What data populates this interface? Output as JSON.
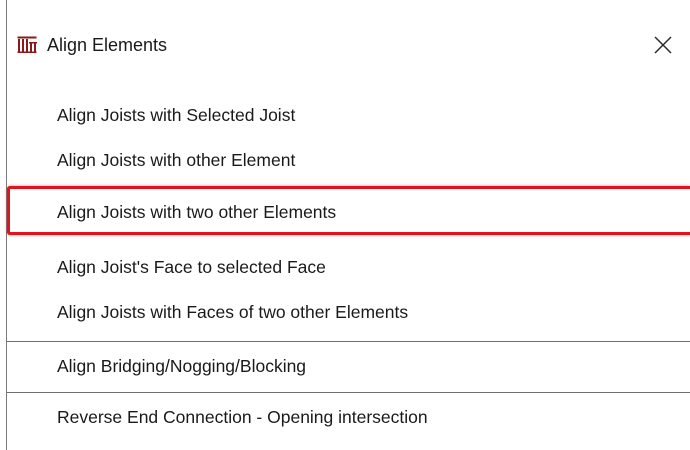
{
  "dialog": {
    "title": "Align Elements",
    "icon": "align-elements-icon",
    "close_icon": "close-icon"
  },
  "menu": {
    "items": [
      {
        "label": "Align Joists with Selected Joist"
      },
      {
        "label": "Align Joists with other Element"
      },
      {
        "label": "Align Joists with two other Elements",
        "highlighted": true
      },
      {
        "label": "Align Joist's Face to selected Face"
      },
      {
        "label": "Align Joists with Faces of two other Elements"
      },
      {
        "label": "Align Bridging/Nogging/Blocking"
      },
      {
        "label": "Reverse End Connection - Opening intersection"
      }
    ]
  },
  "colors": {
    "highlight_border": "#e0141e",
    "text": "#1a1a1a",
    "separator": "#6e6e6e",
    "icon": "#8b1a1a"
  }
}
